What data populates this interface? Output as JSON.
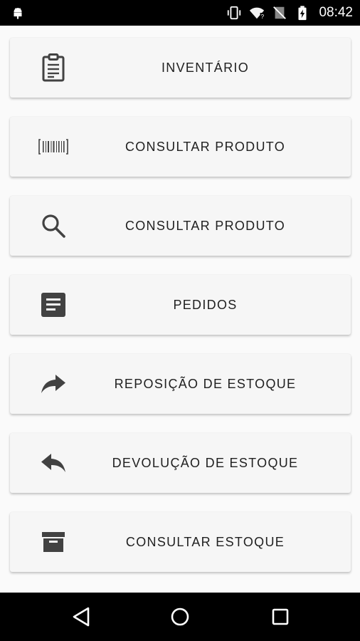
{
  "status_bar": {
    "time": "08:42",
    "icons": [
      "android-icon",
      "vibrate-icon",
      "wifi-icon",
      "no-sim-icon",
      "battery-charging-icon"
    ]
  },
  "menu": {
    "items": [
      {
        "label": "INVENTÁRIO",
        "icon": "clipboard-icon"
      },
      {
        "label": "CONSULTAR PRODUTO",
        "icon": "barcode-icon"
      },
      {
        "label": "CONSULTAR PRODUTO",
        "icon": "search-icon"
      },
      {
        "label": "PEDIDOS",
        "icon": "document-icon"
      },
      {
        "label": "REPOSIÇÃO DE ESTOQUE",
        "icon": "forward-arrow-icon"
      },
      {
        "label": "DEVOLUÇÃO DE ESTOQUE",
        "icon": "reply-arrow-icon"
      },
      {
        "label": "CONSULTAR ESTOQUE",
        "icon": "archive-box-icon"
      }
    ]
  },
  "nav_bar": {
    "buttons": [
      "back-icon",
      "home-icon",
      "recents-icon"
    ]
  },
  "colors": {
    "icon": "#424242",
    "card_bg": "#f6f6f6",
    "page_bg": "#fafafa",
    "text": "#212121",
    "system_bar": "#000000"
  }
}
